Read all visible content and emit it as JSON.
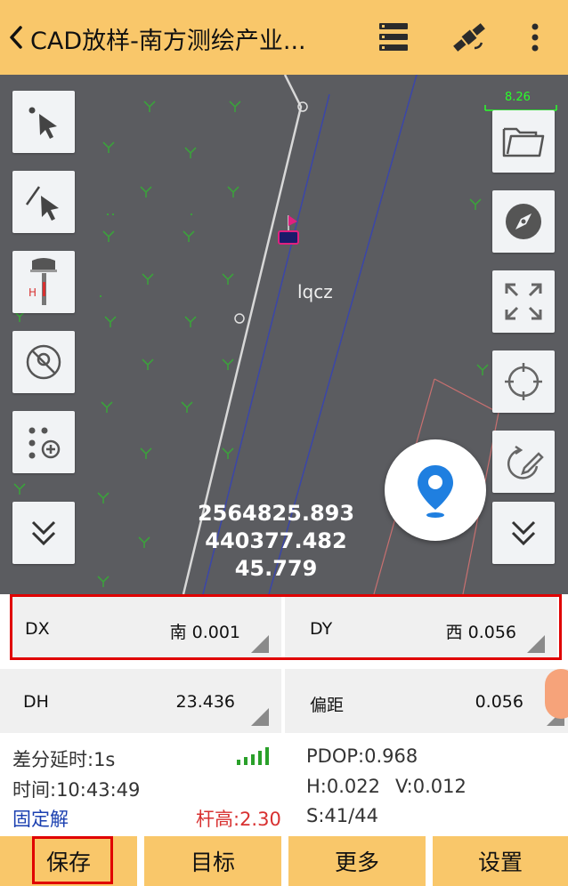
{
  "header": {
    "title": "CAD放样-南方测绘产业...",
    "back_icon": "chevron-left-icon",
    "menu_icon": "list-icon",
    "satellite_icon": "satellite-icon",
    "more_icon": "more-vertical-icon"
  },
  "map": {
    "scale": "8.26",
    "layer_label": "lqcz",
    "coords": {
      "north": "2564825.893",
      "east": "440377.482",
      "height": "45.779"
    },
    "left_tools": [
      "point-select-icon",
      "line-select-icon",
      "rover-icon",
      "no-gps-icon",
      "point-add-icon",
      "expand-more-icon"
    ],
    "right_tools": [
      "folder-icon",
      "compass-icon",
      "fit-extent-icon",
      "target-icon",
      "draw-icon",
      "expand-more-icon"
    ]
  },
  "measurements": {
    "dx": {
      "label": "DX",
      "value": "南 0.001"
    },
    "dy": {
      "label": "DY",
      "value": "西 0.056"
    },
    "dh": {
      "label": "DH",
      "value": "23.436"
    },
    "offset": {
      "label": "偏距",
      "value": "0.056"
    }
  },
  "status": {
    "diff_delay": "差分延时:1s",
    "time": "时间:10:43:49",
    "solution": "固定解",
    "pole_height": "杆高:2.30",
    "pdop": "PDOP:0.968",
    "h": "H:0.022",
    "v": "V:0.012",
    "sats": "S:41/44"
  },
  "buttons": {
    "save": "保存",
    "target": "目标",
    "more": "更多",
    "settings": "设置"
  },
  "colors": {
    "header": "#f9c76a",
    "map_bg": "#5b5c60",
    "highlight": "#e00000",
    "fixed_solution": "#1a3fb0",
    "pole_height": "#d83030",
    "location_pin": "#1f7fe0"
  }
}
